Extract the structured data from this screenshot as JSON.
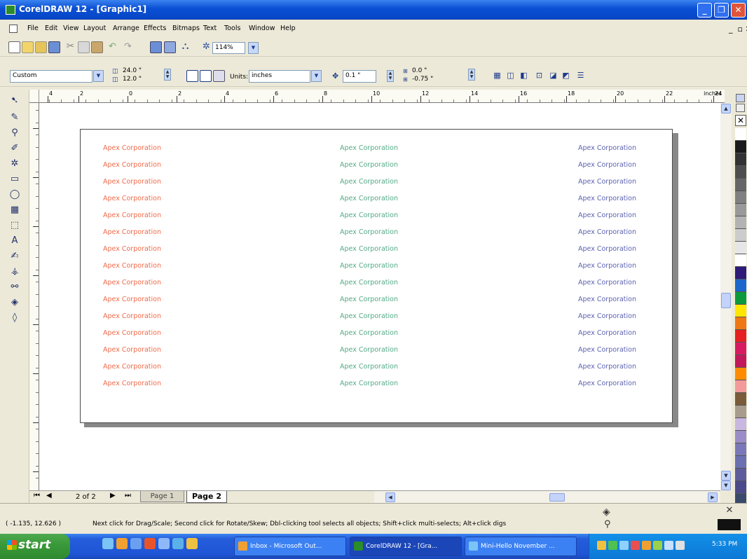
{
  "window": {
    "title": "CorelDRAW 12 - [Graphic1]"
  },
  "menu": [
    "File",
    "Edit",
    "View",
    "Layout",
    "Arrange",
    "Effects",
    "Bitmaps",
    "Text",
    "Tools",
    "Window",
    "Help"
  ],
  "menu_right": "_       ",
  "standard_toolbar": {
    "zoom_level": "114%"
  },
  "property_bar": {
    "page_preset": "Custom",
    "page_width": "24.0 \"",
    "page_height": "12.0 \"",
    "units_label": "Units:",
    "units_value": "inches",
    "nudge": "0.1 \"",
    "dup_x": "0.0 \"",
    "dup_y": "-0.75 \""
  },
  "ruler": {
    "unit": "inches",
    "labels": [
      "4",
      "2",
      "0",
      "2",
      "4",
      "6",
      "8",
      "10",
      "12",
      "14",
      "16",
      "18",
      "20",
      "22",
      "24"
    ]
  },
  "document": {
    "label_text": "Apex Corporation",
    "rows": 15,
    "columns": [
      {
        "color": "#f06a4a",
        "text": "Apex Corporation"
      },
      {
        "color": "#52aa86",
        "text": "Apex Corporation"
      },
      {
        "color": "#5c62b0",
        "text": "Apex Corporation"
      }
    ]
  },
  "page_nav": {
    "counter": "2 of 2",
    "tabs": [
      "Page 1",
      "Page 2"
    ],
    "active_tab": "Page 2"
  },
  "status": {
    "coords": "( -1.135, 12.626 )",
    "hint": "Next click for Drag/Scale; Second click for Rotate/Skew; Dbl-clicking tool selects all objects; Shift+click multi-selects; Alt+click digs"
  },
  "palette_colors": [
    "#ffffff",
    "#1a1a1a",
    "#333333",
    "#4d4d4d",
    "#666666",
    "#808080",
    "#999999",
    "#b3b3b3",
    "#cccccc",
    "#e6e6e6",
    "#ffffff",
    "#2e1a78",
    "#1a66cc",
    "#0a9a3c",
    "#ffe600",
    "#f07814",
    "#e62020",
    "#d81b60",
    "#c2185b",
    "#ff8c00",
    "#f39a9a",
    "#7a5c3a",
    "#a89c8c",
    "#c8b8e0",
    "#9a8cc8",
    "#7a78b8",
    "#6a70b0",
    "#5c5c9c",
    "#4a4a8a",
    "#3a4a6a"
  ],
  "taskbar": {
    "start": "start",
    "tasks": [
      "Inbox - Microsoft Out...",
      "CorelDRAW 12 - [Gra...",
      "Mini-Hello November ..."
    ],
    "clock": "5:33 PM"
  }
}
